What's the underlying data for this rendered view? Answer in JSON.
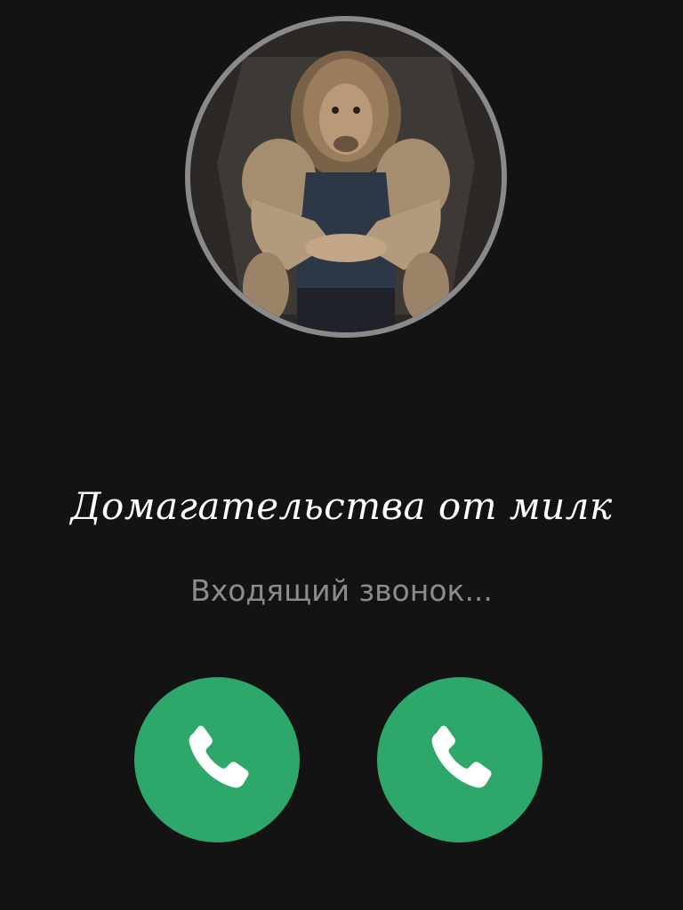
{
  "call": {
    "caller_name": "Домагательства от милк",
    "status": "Входящий звонок..."
  },
  "avatar": {
    "description_icon": "lion-avatar-image"
  },
  "buttons": {
    "left_icon": "phone-icon",
    "right_icon": "phone-icon"
  },
  "colors": {
    "background": "#141314",
    "accept_green": "#2ea86a",
    "status_gray": "#8d8b8d",
    "ring_gray": "#8a8a8a"
  }
}
